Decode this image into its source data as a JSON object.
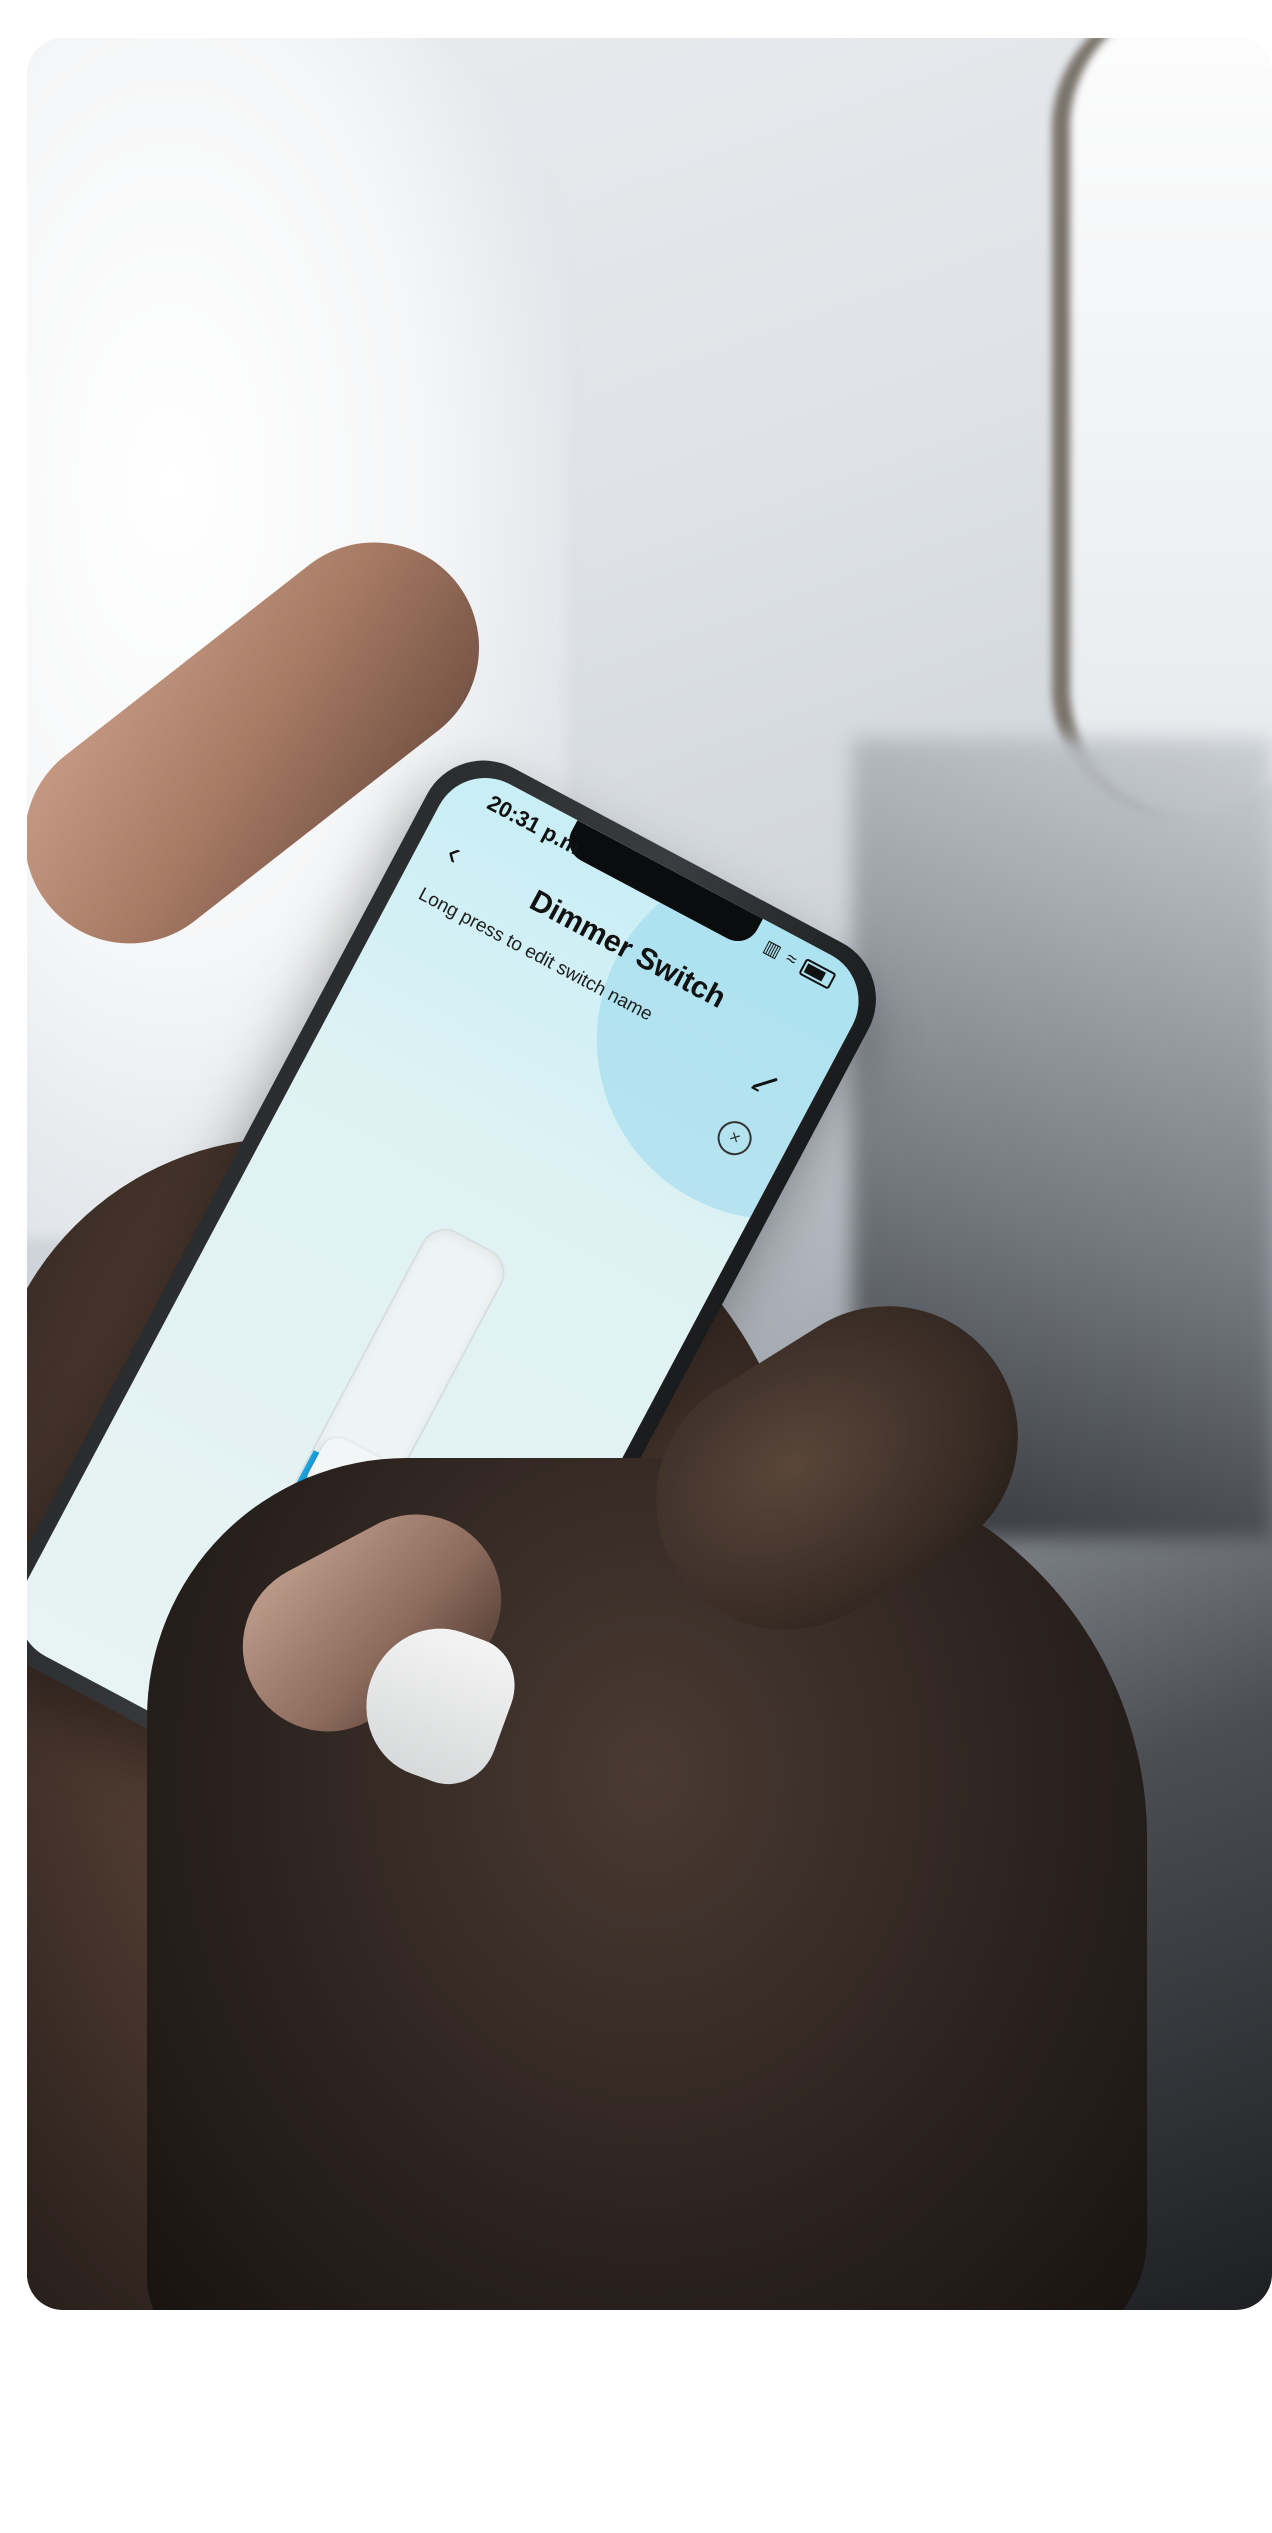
{
  "status_bar": {
    "time": "20:31 p.m."
  },
  "screen": {
    "title": "Dimmer Switch",
    "subtitle": "Long press to edit switch name",
    "back_icon": "chevron-left-icon",
    "edit_icon": "pencil-icon",
    "close_icon": "close-circle-icon",
    "brightness_level": 0.12
  },
  "colors": {
    "accent": "#1aa3de",
    "screen_bg": "#e3f3f4"
  }
}
